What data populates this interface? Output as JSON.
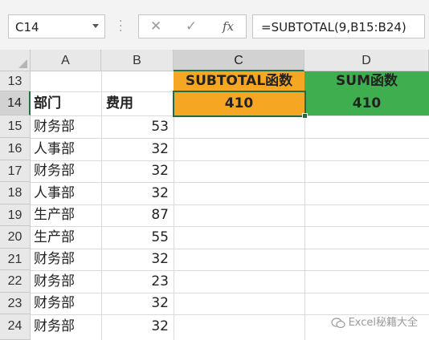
{
  "name_box": {
    "value": "C14"
  },
  "formula_bar": {
    "cancel_glyph": "✕",
    "enter_glyph": "✓",
    "fx_label": "fx",
    "formula": "=SUBTOTAL(9,B15:B24)"
  },
  "columns": [
    "A",
    "B",
    "C",
    "D"
  ],
  "row_numbers": [
    "13",
    "14",
    "15",
    "16",
    "17",
    "18",
    "19",
    "20",
    "21",
    "22",
    "23",
    "24"
  ],
  "headers": {
    "c13": "SUBTOTAL函数",
    "d13": "SUM函数",
    "a14": "部门",
    "b14": "费用",
    "c14": "410",
    "d14": "410"
  },
  "rows": [
    {
      "dept": "财务部",
      "cost": "53"
    },
    {
      "dept": "人事部",
      "cost": "32"
    },
    {
      "dept": "财务部",
      "cost": "32"
    },
    {
      "dept": "人事部",
      "cost": "32"
    },
    {
      "dept": "生产部",
      "cost": "87"
    },
    {
      "dept": "生产部",
      "cost": "55"
    },
    {
      "dept": "财务部",
      "cost": "32"
    },
    {
      "dept": "财务部",
      "cost": "23"
    },
    {
      "dept": "财务部",
      "cost": "32"
    },
    {
      "dept": "财务部",
      "cost": "32"
    }
  ],
  "watermark": "Excel秘籍大全",
  "colors": {
    "orange": "#f5a623",
    "green": "#3fae4f",
    "selection": "#1e6e3d"
  }
}
